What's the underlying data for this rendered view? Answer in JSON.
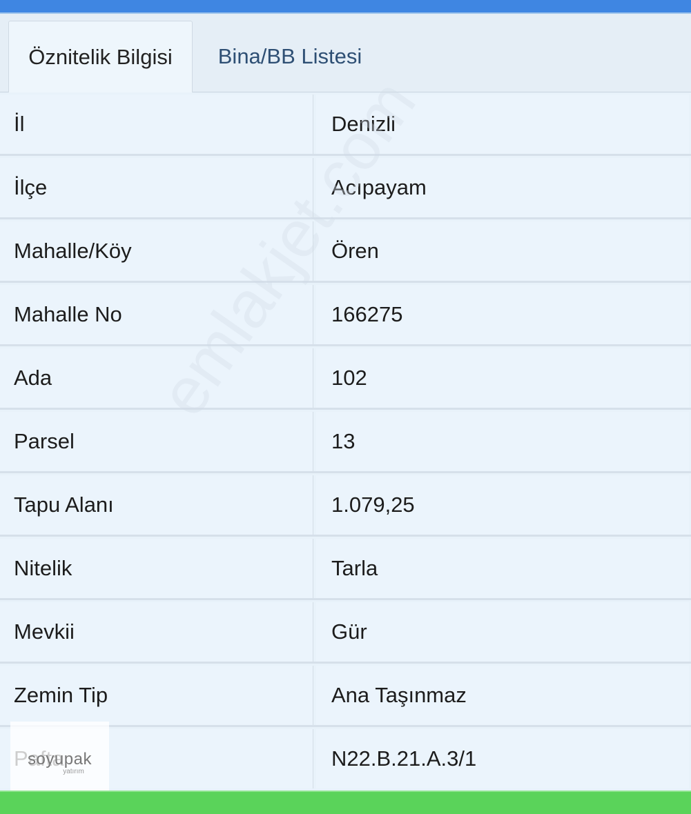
{
  "tabs": {
    "active_label": "Öznitelik Bilgisi",
    "inactive_label": "Bina/BB Listesi"
  },
  "rows": [
    {
      "key": "İl",
      "value": "Denizli"
    },
    {
      "key": "İlçe",
      "value": "Acıpayam"
    },
    {
      "key": "Mahalle/Köy",
      "value": "Ören"
    },
    {
      "key": "Mahalle No",
      "value": "166275"
    },
    {
      "key": "Ada",
      "value": "102"
    },
    {
      "key": "Parsel",
      "value": "13"
    },
    {
      "key": "Tapu Alanı",
      "value": "1.079,25"
    },
    {
      "key": "Nitelik",
      "value": "Tarla"
    },
    {
      "key": "Mevkii",
      "value": "Gür"
    },
    {
      "key": "Zemin Tip",
      "value": "Ana Taşınmaz"
    },
    {
      "key": "Pafta",
      "value": "N22.B.21.A.3/1"
    }
  ],
  "watermark": "emlakjet.com",
  "logo": {
    "main": "soyupak",
    "sub": "yatırım"
  },
  "colors": {
    "top_bar": "#3f86e2",
    "bottom_bar": "#5ad35a",
    "inactive_tab_text": "#2e4f74"
  }
}
